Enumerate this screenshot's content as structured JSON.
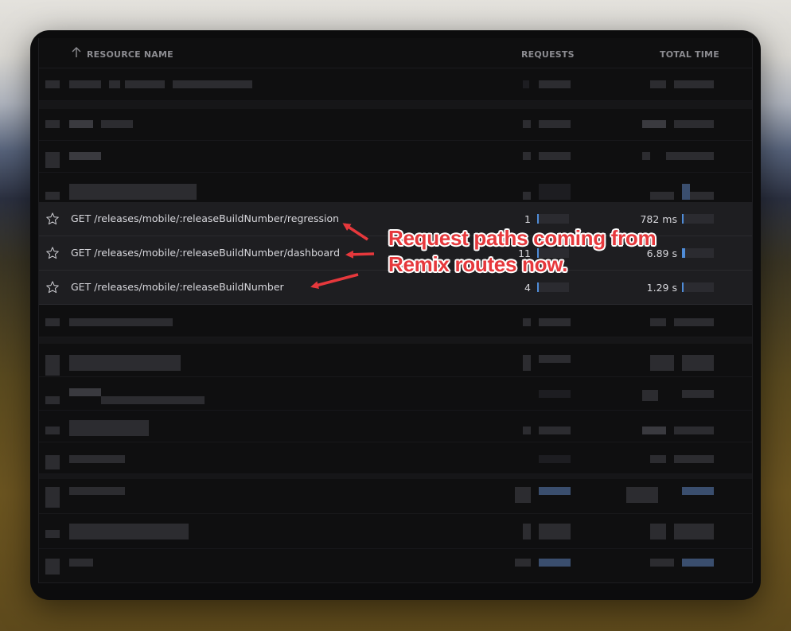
{
  "header": {
    "resource_name": "RESOURCE NAME",
    "requests": "REQUESTS",
    "total_time": "TOTAL TIME"
  },
  "highlighted_rows": [
    {
      "path": "GET /releases/mobile/:releaseBuildNumber/regression",
      "requests": "1",
      "total_time": "782 ms",
      "requests_fill": 0.02,
      "time_fill": 0.03
    },
    {
      "path": "GET /releases/mobile/:releaseBuildNumber/dashboard",
      "requests": "11",
      "total_time": "6.89 s",
      "requests_fill": 0.05,
      "time_fill": 0.1
    },
    {
      "path": "GET /releases/mobile/:releaseBuildNumber",
      "requests": "4",
      "total_time": "1.29 s",
      "requests_fill": 0.03,
      "time_fill": 0.04
    }
  ],
  "annotation": {
    "line1": "Request paths coming from",
    "line2": "Remix routes now."
  },
  "colors": {
    "annotation": "#e6383c",
    "bar_fill": "#4f8cd8",
    "window_bg": "#0c0c0d"
  },
  "icons": {
    "sort": "arrow-up-icon",
    "favorite": "star-outline-icon"
  }
}
